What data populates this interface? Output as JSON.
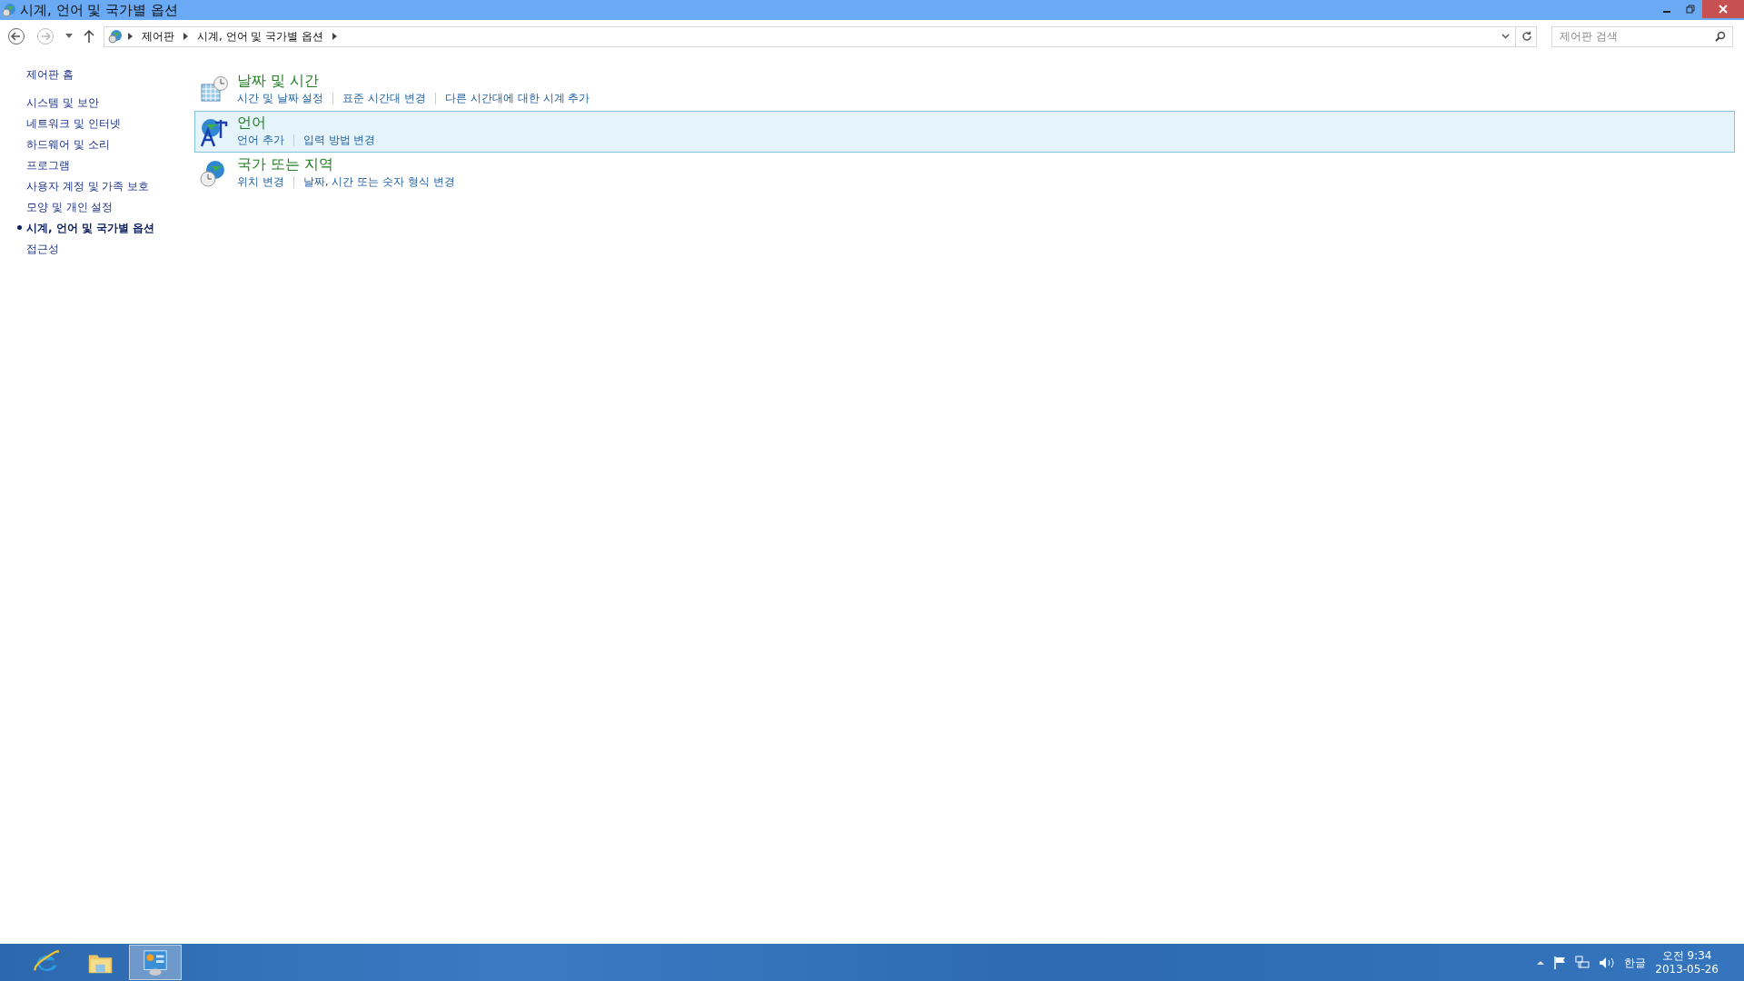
{
  "window": {
    "title": "시계, 언어 및 국가별 옵션"
  },
  "address": {
    "breadcrumb": [
      "제어판",
      "시계, 언어 및 국가별 옵션"
    ]
  },
  "search": {
    "placeholder": "제어판 검색"
  },
  "sidebar": {
    "home": "제어판 홈",
    "items": [
      {
        "label": "시스템 및 보안",
        "selected": false
      },
      {
        "label": "네트워크 및 인터넷",
        "selected": false
      },
      {
        "label": "하드웨어 및 소리",
        "selected": false
      },
      {
        "label": "프로그램",
        "selected": false
      },
      {
        "label": "사용자 계정 및 가족 보호",
        "selected": false
      },
      {
        "label": "모양 및 개인 설정",
        "selected": false
      },
      {
        "label": "시계, 언어 및 국가별 옵션",
        "selected": true
      },
      {
        "label": "접근성",
        "selected": false
      }
    ]
  },
  "categories": [
    {
      "kind": "clock",
      "title": "날짜 및 시간",
      "selected": false,
      "links": [
        "시간 및 날짜 설정",
        "표준 시간대 변경",
        "다른 시간대에 대한 시계 추가"
      ]
    },
    {
      "kind": "language",
      "title": "언어",
      "selected": true,
      "links": [
        "언어 추가",
        "입력 방법 변경"
      ]
    },
    {
      "kind": "region",
      "title": "국가 또는 지역",
      "selected": false,
      "links": [
        "위치 변경",
        "날짜, 시간 또는 숫자 형식 변경"
      ]
    }
  ],
  "taskbar": {
    "apps": [
      {
        "kind": "browser",
        "selected": false
      },
      {
        "kind": "folder",
        "selected": false
      },
      {
        "kind": "control-panel",
        "selected": true
      }
    ],
    "ime": "한글",
    "time": "오전 9:34",
    "date": "2013-05-26"
  }
}
